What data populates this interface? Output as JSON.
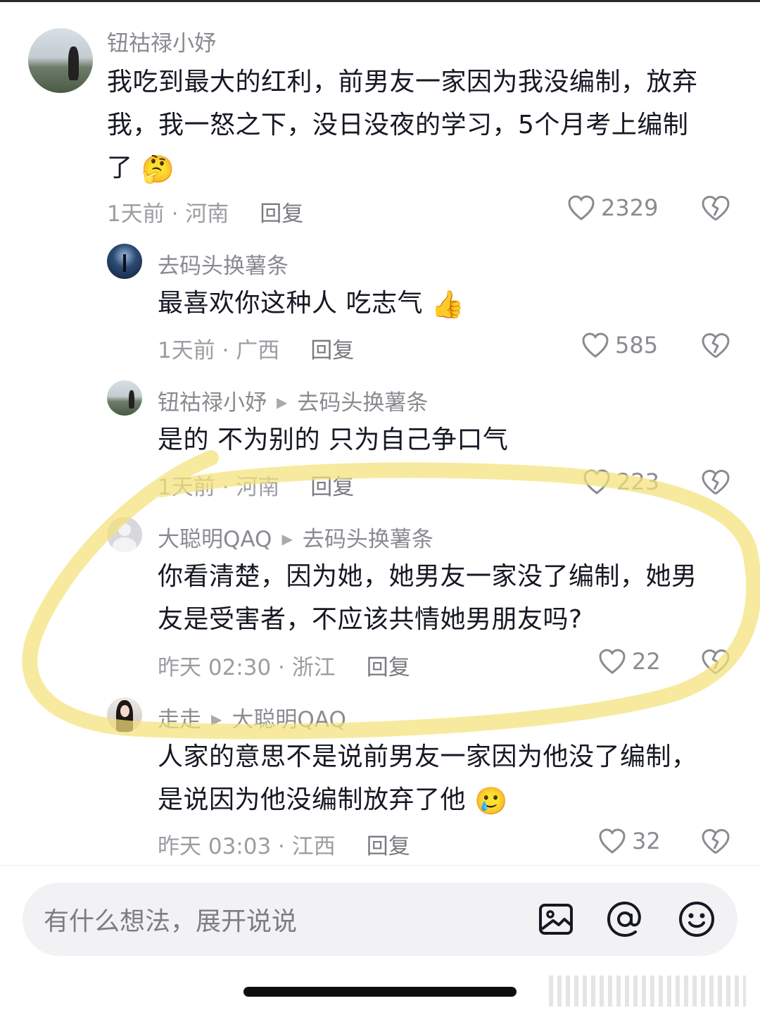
{
  "comments": [
    {
      "user": "钮祜禄小妤",
      "lines": [
        "我吃到最大的红利，前男友一家因为我没编制，放弃",
        "我，我一怒之下，没日没夜的学习，5个月考上编制",
        "了"
      ],
      "emoji": "🤔",
      "time": "1天前",
      "location": "河南",
      "reply": "回复",
      "likes": "2329"
    },
    {
      "user": "去码头换薯条",
      "lines": [
        "最喜欢你这种人 吃志气"
      ],
      "emoji": "👍",
      "time": "1天前",
      "location": "广西",
      "reply": "回复",
      "likes": "585"
    },
    {
      "user": "钮祜禄小妤",
      "reply_to": "去码头换薯条",
      "lines": [
        "是的 不为别的 只为自己争口气"
      ],
      "time": "1天前",
      "location": "河南",
      "reply": "回复",
      "likes": "223"
    },
    {
      "user": "大聪明QAQ",
      "reply_to": "去码头换薯条",
      "lines": [
        "你看清楚，因为她，她男友一家没了编制，她男",
        "友是受害者，不应该共情她男朋友吗?"
      ],
      "time": "昨天 02:30",
      "location": "浙江",
      "reply": "回复",
      "likes": "22"
    },
    {
      "user": "走走",
      "reply_to": "大聪明QAQ",
      "lines": [
        "人家的意思不是说前男友一家因为他没了编制，",
        "是说因为他没编制放弃了他"
      ],
      "emoji": "🥲",
      "time": "昨天 03:03",
      "location": "江西",
      "reply": "回复",
      "likes": "32"
    }
  ],
  "input": {
    "placeholder": "有什么想法，展开说说",
    "image_icon": "image-icon",
    "mention_icon": "at-mention-icon",
    "emoji_icon": "smiley-icon"
  },
  "colors": {
    "text": "#161823",
    "secondary": "#8a8b91",
    "highlight": "#f4e27a"
  }
}
